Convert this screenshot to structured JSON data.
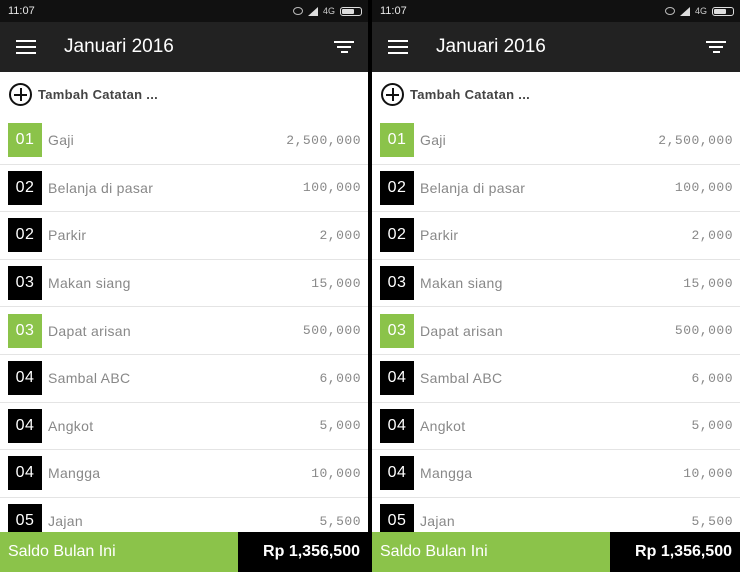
{
  "status": {
    "time": "11:07",
    "network": "4G"
  },
  "header": {
    "title": "Januari 2016"
  },
  "add": {
    "label": "Tambah Catatan ..."
  },
  "entries": [
    {
      "day": "01",
      "desc": "Gaji",
      "amount": "2,500,000",
      "type": "income"
    },
    {
      "day": "02",
      "desc": "Belanja di pasar",
      "amount": "100,000",
      "type": "expense"
    },
    {
      "day": "02",
      "desc": "Parkir",
      "amount": "2,000",
      "type": "expense"
    },
    {
      "day": "03",
      "desc": "Makan siang",
      "amount": "15,000",
      "type": "expense"
    },
    {
      "day": "03",
      "desc": "Dapat arisan",
      "amount": "500,000",
      "type": "income"
    },
    {
      "day": "04",
      "desc": "Sambal ABC",
      "amount": "6,000",
      "type": "expense"
    },
    {
      "day": "04",
      "desc": "Angkot",
      "amount": "5,000",
      "type": "expense"
    },
    {
      "day": "04",
      "desc": "Mangga",
      "amount": "10,000",
      "type": "expense"
    },
    {
      "day": "05",
      "desc": "Jajan",
      "amount": "5,500",
      "type": "expense"
    }
  ],
  "footer": {
    "label": "Saldo Bulan Ini",
    "value": "Rp 1,356,500"
  },
  "colors": {
    "income": "#8bc34a",
    "expense": "#000000",
    "appbar": "#222222"
  }
}
